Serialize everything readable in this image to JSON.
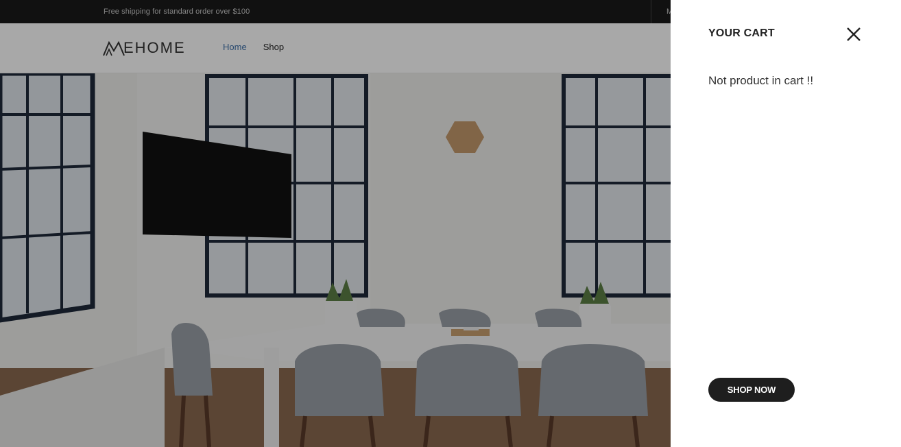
{
  "topbar": {
    "announcement": "Free shipping for standard order over $100",
    "right_text": "M"
  },
  "header": {
    "logo_text": "EHOME",
    "nav": [
      {
        "label": "Home",
        "active": true
      },
      {
        "label": "Shop",
        "active": false
      }
    ]
  },
  "cart": {
    "title": "YOUR CART",
    "empty_message": "Not product in cart !!",
    "shop_now_label": "SHOP NOW",
    "close_icon": "close-icon"
  },
  "colors": {
    "topbar_bg": "#1b1b1b",
    "nav_active": "#3d6fa8",
    "button_bg": "#1e1e1e",
    "overlay": "rgba(0,0,0,0.34)"
  }
}
